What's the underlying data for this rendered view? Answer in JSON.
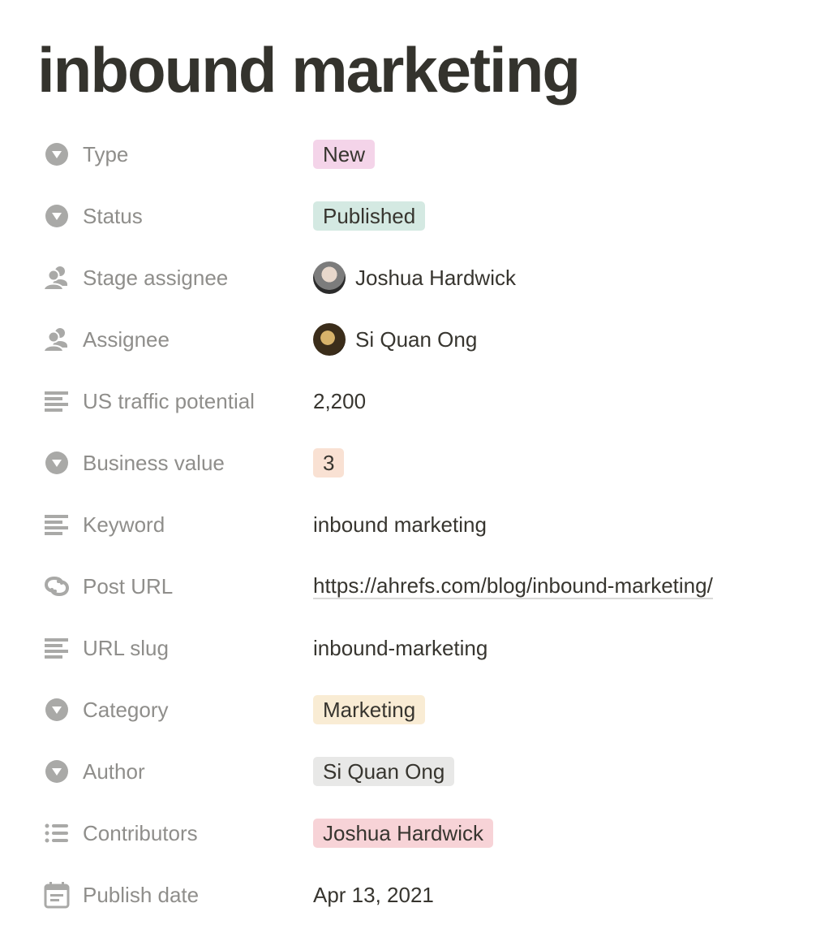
{
  "page": {
    "title": "inbound marketing"
  },
  "properties": [
    {
      "icon": "select-icon",
      "label": "Type",
      "kind": "tag",
      "value": "New",
      "color": "#f4d4e9"
    },
    {
      "icon": "select-icon",
      "label": "Status",
      "kind": "tag",
      "value": "Published",
      "color": "#d4e9e2"
    },
    {
      "icon": "person-icon",
      "label": "Stage assignee",
      "kind": "person",
      "value": "Joshua Hardwick"
    },
    {
      "icon": "person-icon",
      "label": "Assignee",
      "kind": "person",
      "value": "Si Quan Ong"
    },
    {
      "icon": "text-icon",
      "label": "US traffic potential",
      "kind": "text",
      "value": "2,200"
    },
    {
      "icon": "select-icon",
      "label": "Business value",
      "kind": "tag",
      "value": "3",
      "color": "#f9e1d3"
    },
    {
      "icon": "text-icon",
      "label": "Keyword",
      "kind": "text",
      "value": "inbound marketing"
    },
    {
      "icon": "link-icon",
      "label": "Post URL",
      "kind": "url",
      "value": "https://ahrefs.com/blog/inbound-marketing/"
    },
    {
      "icon": "text-icon",
      "label": "URL slug",
      "kind": "text",
      "value": "inbound-marketing"
    },
    {
      "icon": "select-icon",
      "label": "Category",
      "kind": "tag",
      "value": "Marketing",
      "color": "#f9ecd4"
    },
    {
      "icon": "select-icon",
      "label": "Author",
      "kind": "tag",
      "value": "Si Quan Ong",
      "color": "#e8e8e7"
    },
    {
      "icon": "list-icon",
      "label": "Contributors",
      "kind": "tag",
      "value": "Joshua Hardwick",
      "color": "#f7d3d7"
    },
    {
      "icon": "calendar-icon",
      "label": "Publish date",
      "kind": "text",
      "value": "Apr 13, 2021"
    }
  ]
}
